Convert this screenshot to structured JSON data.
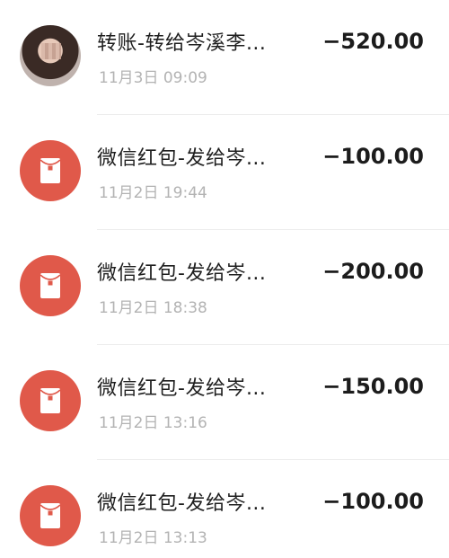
{
  "transactions": [
    {
      "title": "转账-转给岑溪李...",
      "time": "11月3日 09:09",
      "amount": "−520.00",
      "avatar": "contact-photo"
    },
    {
      "title": "微信红包-发给岑...",
      "time": "11月2日 19:44",
      "amount": "−100.00",
      "avatar": "red-packet-icon"
    },
    {
      "title": "微信红包-发给岑...",
      "time": "11月2日 18:38",
      "amount": "−200.00",
      "avatar": "red-packet-icon"
    },
    {
      "title": "微信红包-发给岑...",
      "time": "11月2日 13:16",
      "amount": "−150.00",
      "avatar": "red-packet-icon"
    },
    {
      "title": "微信红包-发给岑...",
      "time": "11月2日 13:13",
      "amount": "−100.00",
      "avatar": "red-packet-icon"
    }
  ],
  "colors": {
    "red_packet": "#e0594a",
    "title_text": "#1f1f1f",
    "time_text": "#b3b3b3",
    "amount_text": "#1c1c1c",
    "divider": "#ececec"
  }
}
